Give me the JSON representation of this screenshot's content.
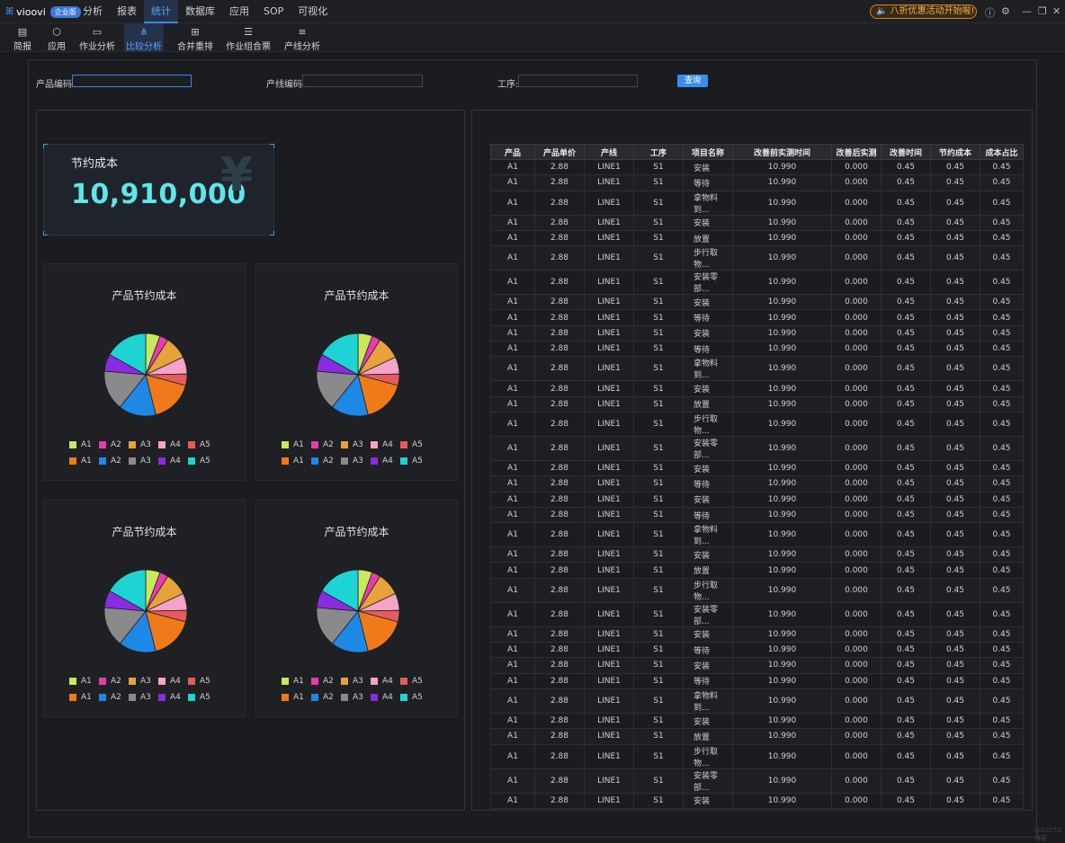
{
  "app": {
    "name": "vioovi",
    "edition_badge": "企业版"
  },
  "menu": [
    {
      "label": "分析",
      "active": false
    },
    {
      "label": "报表",
      "active": false
    },
    {
      "label": "统计",
      "active": true
    },
    {
      "label": "数据库",
      "active": false
    },
    {
      "label": "应用",
      "active": false
    },
    {
      "label": "SOP",
      "active": false
    },
    {
      "label": "可视化",
      "active": false
    }
  ],
  "promo": {
    "text": "八折优惠活动开始啦!",
    "close": "×"
  },
  "window_icons": {
    "info": "ⓘ",
    "settings": "⚙",
    "minimize": "—",
    "restore": "❐",
    "close": "✕"
  },
  "toolbar": [
    {
      "label": "简报",
      "icon": "document-icon",
      "glyph": "▤",
      "active": false
    },
    {
      "label": "应用",
      "icon": "cube-icon",
      "glyph": "⬡",
      "active": false
    },
    {
      "label": "作业分析",
      "icon": "chart-icon",
      "glyph": "▭",
      "active": false
    },
    {
      "label": "比较分析",
      "icon": "network-icon",
      "glyph": "⋔",
      "active": true
    },
    {
      "label": "合并重排",
      "icon": "merge-icon",
      "glyph": "⊞",
      "active": false
    },
    {
      "label": "作业组合票",
      "icon": "layers-icon",
      "glyph": "☰",
      "active": false
    },
    {
      "label": "产线分析",
      "icon": "sliders-icon",
      "glyph": "≡",
      "active": false
    }
  ],
  "filters": {
    "product_code_label": "产品编码:",
    "product_code_value": "",
    "line_code_label": "产线编码:",
    "line_code_value": "",
    "process_label": "工序:",
    "process_value": "",
    "query_button": "查询"
  },
  "kpi": {
    "title": "节约成本",
    "value": "10,910,000",
    "icon": "yen-icon",
    "glyph": "¥"
  },
  "chart_data": [
    {
      "type": "pie",
      "title": "产品节约成本",
      "legend": [
        "A1",
        "A2",
        "A3",
        "A4",
        "A5",
        "A1",
        "A2",
        "A3",
        "A4",
        "A5"
      ],
      "colors": [
        "#c9e85b",
        "#e83bb0",
        "#e8a23a",
        "#f5a3c7",
        "#e65c5c",
        "#f07a1a",
        "#1e88e5",
        "#8a8a8a",
        "#8a2be2",
        "#1ed3d3"
      ],
      "values": [
        5,
        3,
        8,
        6,
        4,
        15,
        13,
        14,
        6,
        15
      ]
    },
    {
      "type": "pie",
      "title": "产品节约成本",
      "legend": [
        "A1",
        "A2",
        "A3",
        "A4",
        "A5",
        "A1",
        "A2",
        "A3",
        "A4",
        "A5"
      ],
      "colors": [
        "#c9e85b",
        "#e83bb0",
        "#e8a23a",
        "#f5a3c7",
        "#e65c5c",
        "#f07a1a",
        "#1e88e5",
        "#8a8a8a",
        "#8a2be2",
        "#1ed3d3"
      ],
      "values": [
        5,
        3,
        8,
        6,
        4,
        15,
        13,
        14,
        6,
        15
      ]
    },
    {
      "type": "pie",
      "title": "产品节约成本",
      "legend": [
        "A1",
        "A2",
        "A3",
        "A4",
        "A5",
        "A1",
        "A2",
        "A3",
        "A4",
        "A5"
      ],
      "colors": [
        "#c9e85b",
        "#e83bb0",
        "#e8a23a",
        "#f5a3c7",
        "#e65c5c",
        "#f07a1a",
        "#1e88e5",
        "#8a8a8a",
        "#8a2be2",
        "#1ed3d3"
      ],
      "values": [
        5,
        3,
        8,
        6,
        4,
        15,
        13,
        14,
        6,
        15
      ]
    },
    {
      "type": "pie",
      "title": "产品节约成本",
      "legend": [
        "A1",
        "A2",
        "A3",
        "A4",
        "A5",
        "A1",
        "A2",
        "A3",
        "A4",
        "A5"
      ],
      "colors": [
        "#c9e85b",
        "#e83bb0",
        "#e8a23a",
        "#f5a3c7",
        "#e65c5c",
        "#f07a1a",
        "#1e88e5",
        "#8a8a8a",
        "#8a2be2",
        "#1ed3d3"
      ],
      "values": [
        5,
        3,
        8,
        6,
        4,
        15,
        13,
        14,
        6,
        15
      ]
    }
  ],
  "table": {
    "columns": [
      "产品",
      "产品单价",
      "产线",
      "工序",
      "项目名称",
      "改善前实测时间",
      "改善后实测",
      "改善时间",
      "节约成本",
      "成本占比"
    ],
    "rows": [
      [
        "A1",
        "2.88",
        "LINE1",
        "S1",
        "安装",
        "10.990",
        "0.000",
        "0.45",
        "0.45",
        "0.45"
      ],
      [
        "A1",
        "2.88",
        "LINE1",
        "S1",
        "等待",
        "10.990",
        "0.000",
        "0.45",
        "0.45",
        "0.45"
      ],
      [
        "A1",
        "2.88",
        "LINE1",
        "S1",
        "拿物料到...",
        "10.990",
        "0.000",
        "0.45",
        "0.45",
        "0.45"
      ],
      [
        "A1",
        "2.88",
        "LINE1",
        "S1",
        "安装",
        "10.990",
        "0.000",
        "0.45",
        "0.45",
        "0.45"
      ],
      [
        "A1",
        "2.88",
        "LINE1",
        "S1",
        "放置",
        "10.990",
        "0.000",
        "0.45",
        "0.45",
        "0.45"
      ],
      [
        "A1",
        "2.88",
        "LINE1",
        "S1",
        "步行取物...",
        "10.990",
        "0.000",
        "0.45",
        "0.45",
        "0.45"
      ],
      [
        "A1",
        "2.88",
        "LINE1",
        "S1",
        "安装零部...",
        "10.990",
        "0.000",
        "0.45",
        "0.45",
        "0.45"
      ],
      [
        "A1",
        "2.88",
        "LINE1",
        "S1",
        "安装",
        "10.990",
        "0.000",
        "0.45",
        "0.45",
        "0.45"
      ],
      [
        "A1",
        "2.88",
        "LINE1",
        "S1",
        "等待",
        "10.990",
        "0.000",
        "0.45",
        "0.45",
        "0.45"
      ],
      [
        "A1",
        "2.88",
        "LINE1",
        "S1",
        "安装",
        "10.990",
        "0.000",
        "0.45",
        "0.45",
        "0.45"
      ],
      [
        "A1",
        "2.88",
        "LINE1",
        "S1",
        "等待",
        "10.990",
        "0.000",
        "0.45",
        "0.45",
        "0.45"
      ],
      [
        "A1",
        "2.88",
        "LINE1",
        "S1",
        "拿物料到...",
        "10.990",
        "0.000",
        "0.45",
        "0.45",
        "0.45"
      ],
      [
        "A1",
        "2.88",
        "LINE1",
        "S1",
        "安装",
        "10.990",
        "0.000",
        "0.45",
        "0.45",
        "0.45"
      ],
      [
        "A1",
        "2.88",
        "LINE1",
        "S1",
        "放置",
        "10.990",
        "0.000",
        "0.45",
        "0.45",
        "0.45"
      ],
      [
        "A1",
        "2.88",
        "LINE1",
        "S1",
        "步行取物...",
        "10.990",
        "0.000",
        "0.45",
        "0.45",
        "0.45"
      ],
      [
        "A1",
        "2.88",
        "LINE1",
        "S1",
        "安装零部...",
        "10.990",
        "0.000",
        "0.45",
        "0.45",
        "0.45"
      ],
      [
        "A1",
        "2.88",
        "LINE1",
        "S1",
        "安装",
        "10.990",
        "0.000",
        "0.45",
        "0.45",
        "0.45"
      ],
      [
        "A1",
        "2.88",
        "LINE1",
        "S1",
        "等待",
        "10.990",
        "0.000",
        "0.45",
        "0.45",
        "0.45"
      ],
      [
        "A1",
        "2.88",
        "LINE1",
        "S1",
        "安装",
        "10.990",
        "0.000",
        "0.45",
        "0.45",
        "0.45"
      ],
      [
        "A1",
        "2.88",
        "LINE1",
        "S1",
        "等待",
        "10.990",
        "0.000",
        "0.45",
        "0.45",
        "0.45"
      ],
      [
        "A1",
        "2.88",
        "LINE1",
        "S1",
        "拿物料到...",
        "10.990",
        "0.000",
        "0.45",
        "0.45",
        "0.45"
      ],
      [
        "A1",
        "2.88",
        "LINE1",
        "S1",
        "安装",
        "10.990",
        "0.000",
        "0.45",
        "0.45",
        "0.45"
      ],
      [
        "A1",
        "2.88",
        "LINE1",
        "S1",
        "放置",
        "10.990",
        "0.000",
        "0.45",
        "0.45",
        "0.45"
      ],
      [
        "A1",
        "2.88",
        "LINE1",
        "S1",
        "步行取物...",
        "10.990",
        "0.000",
        "0.45",
        "0.45",
        "0.45"
      ],
      [
        "A1",
        "2.88",
        "LINE1",
        "S1",
        "安装零部...",
        "10.990",
        "0.000",
        "0.45",
        "0.45",
        "0.45"
      ],
      [
        "A1",
        "2.88",
        "LINE1",
        "S1",
        "安装",
        "10.990",
        "0.000",
        "0.45",
        "0.45",
        "0.45"
      ],
      [
        "A1",
        "2.88",
        "LINE1",
        "S1",
        "等待",
        "10.990",
        "0.000",
        "0.45",
        "0.45",
        "0.45"
      ],
      [
        "A1",
        "2.88",
        "LINE1",
        "S1",
        "安装",
        "10.990",
        "0.000",
        "0.45",
        "0.45",
        "0.45"
      ],
      [
        "A1",
        "2.88",
        "LINE1",
        "S1",
        "等待",
        "10.990",
        "0.000",
        "0.45",
        "0.45",
        "0.45"
      ],
      [
        "A1",
        "2.88",
        "LINE1",
        "S1",
        "拿物料到...",
        "10.990",
        "0.000",
        "0.45",
        "0.45",
        "0.45"
      ],
      [
        "A1",
        "2.88",
        "LINE1",
        "S1",
        "安装",
        "10.990",
        "0.000",
        "0.45",
        "0.45",
        "0.45"
      ],
      [
        "A1",
        "2.88",
        "LINE1",
        "S1",
        "放置",
        "10.990",
        "0.000",
        "0.45",
        "0.45",
        "0.45"
      ],
      [
        "A1",
        "2.88",
        "LINE1",
        "S1",
        "步行取物...",
        "10.990",
        "0.000",
        "0.45",
        "0.45",
        "0.45"
      ],
      [
        "A1",
        "2.88",
        "LINE1",
        "S1",
        "安装零部...",
        "10.990",
        "0.000",
        "0.45",
        "0.45",
        "0.45"
      ],
      [
        "A1",
        "2.88",
        "LINE1",
        "S1",
        "安装",
        "10.990",
        "0.000",
        "0.45",
        "0.45",
        "0.45"
      ]
    ]
  },
  "watermark": "@51CTO博客"
}
